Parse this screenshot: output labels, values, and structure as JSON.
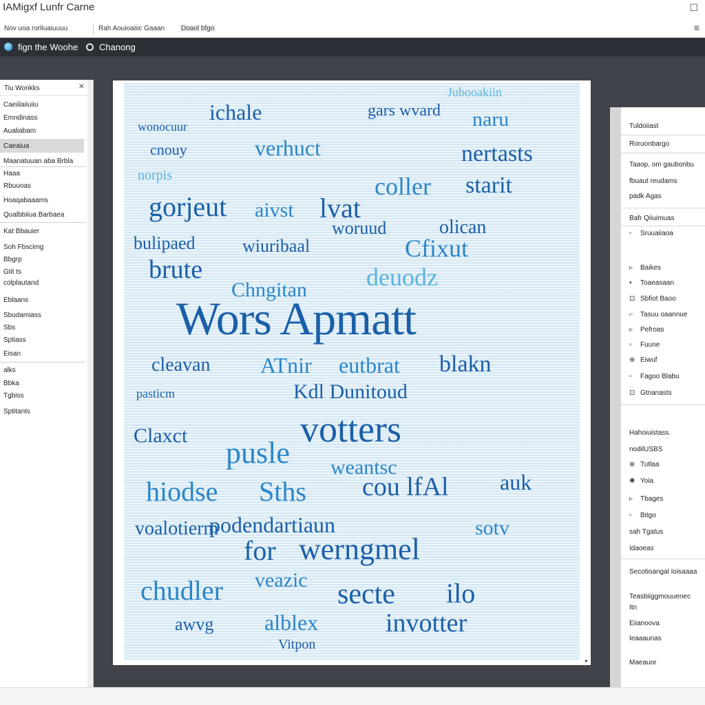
{
  "app": {
    "title": "IAMigxf Lunfr Carne"
  },
  "toolbar": {
    "items": [
      "Nov uoa rorliuaiuuuu",
      "Rah Aouioaiiic Gaaan",
      "Doaol bfgo"
    ]
  },
  "tabs": [
    "fign the Woohe",
    "Chanong"
  ],
  "left_panel": {
    "title": "Tiu Wonkks",
    "items": [
      "Caeiilaiiuiiu",
      "Emndinass",
      "Aualiabam",
      "Caeaiua",
      "Maanatuuan aba Brbla",
      "Haaa",
      "Rbuuoas",
      "Hoaqabaaams",
      "Qualbbiiua Barbaea",
      "Kat Bbauier",
      "Soh Fbscimg",
      "Bbgrp",
      "Gtit ts",
      "colplautand",
      "Eblaans",
      "Sbudamiass",
      "Sbs",
      "Sptiass",
      "Eisan",
      "alks",
      "Bbka",
      "Tgbiss",
      "Sptitants"
    ]
  },
  "canvas": {
    "words": [
      "ichale",
      "gars wvard",
      "naru",
      "Jubooakiin",
      "wonocuur",
      "cnouy",
      "verhuct",
      "nertasts",
      "norpis",
      "coller",
      "starit",
      "gorjeut",
      "aivst",
      "lvat",
      "woruud",
      "olican",
      "Cfixut",
      "bulipaed",
      "wiuribaal",
      "brute",
      "deuodz",
      "Chngitan",
      "Wors Apmatt",
      "cleavan",
      "ATnir",
      "eutbrat",
      "blakn",
      "pasticm",
      "Kdl Dunitoud",
      "votters",
      "Claxct",
      "pusle",
      "weantsc",
      "hiodse",
      "Sths",
      "cou lfAl",
      "auk",
      "podendartiaun",
      "sotv",
      "voalotierm",
      "for",
      "werngmel",
      "chudler",
      "veazic",
      "secte",
      "ilo",
      "awvg",
      "alblex",
      "invotter",
      "Vitpon"
    ],
    "corner": "▸"
  },
  "right_panel": {
    "items": [
      "Tuldoiiast",
      "Roruonbargo",
      "Taaop, om gaubonbu",
      "fbuaut reudams",
      "padk Agas",
      "Bafr Qiiuimuas",
      "Sruuaiiaoa",
      "Baikes",
      "Toaeasaan",
      "Sbfiot Baoo",
      "Tasuu oaannue",
      "Pefroas",
      "Fuune",
      "Eiwuf",
      "Fagoo Blabu",
      "Gtnanasts",
      "Hahoiuistass.",
      "nodilUSBS",
      "Tutlaa",
      "Yoia",
      "Tbages",
      "Bitgo",
      "sah Tgatus",
      "Idaoeas",
      "Secotioangal Ioisaaaa",
      "Teasbiiggmouuenec",
      "Itn",
      "Eiianoova",
      "Ieaaaunas",
      "Maeauor"
    ],
    "icons": [
      "▫",
      "▹",
      "▪",
      "⊡",
      "⌐",
      "▹",
      "▫",
      "⊕",
      "▫",
      "⊡",
      "⊗",
      "✺",
      "▹",
      "▫"
    ]
  },
  "colors": {
    "chrome_dark": "#2c3036",
    "workspace": "#40434a",
    "word_dark": "#1b5fa8",
    "word_mid": "#2b86c8",
    "word_light": "#5bb3dd"
  }
}
